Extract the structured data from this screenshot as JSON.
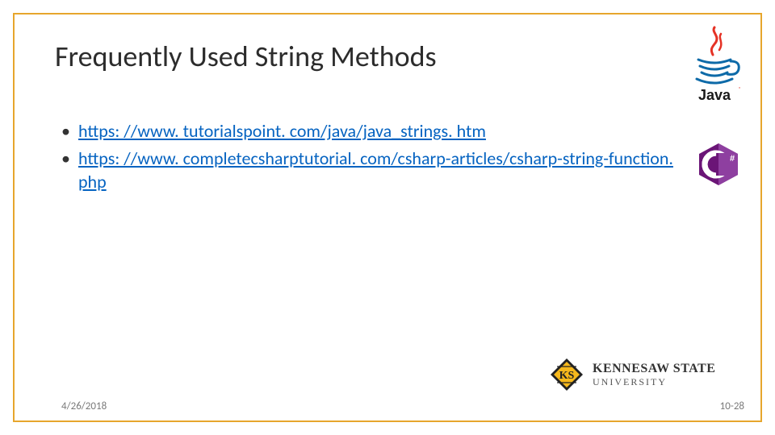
{
  "title": "Frequently Used String Methods",
  "bullets": [
    {
      "text": "https: //www. tutorialspoint. com/java/java_strings. htm"
    },
    {
      "text": "https: //www. completecsharptutorial. com/csharp-articles/csharp-string-function. php"
    }
  ],
  "footer": {
    "date": "4/26/2018",
    "slide_number": "10-28"
  },
  "logos": {
    "java_label": "Java",
    "csharp_label": "C#",
    "ksu_line1": "KENNESAW STATE",
    "ksu_line2": "UNIVERSITY"
  }
}
